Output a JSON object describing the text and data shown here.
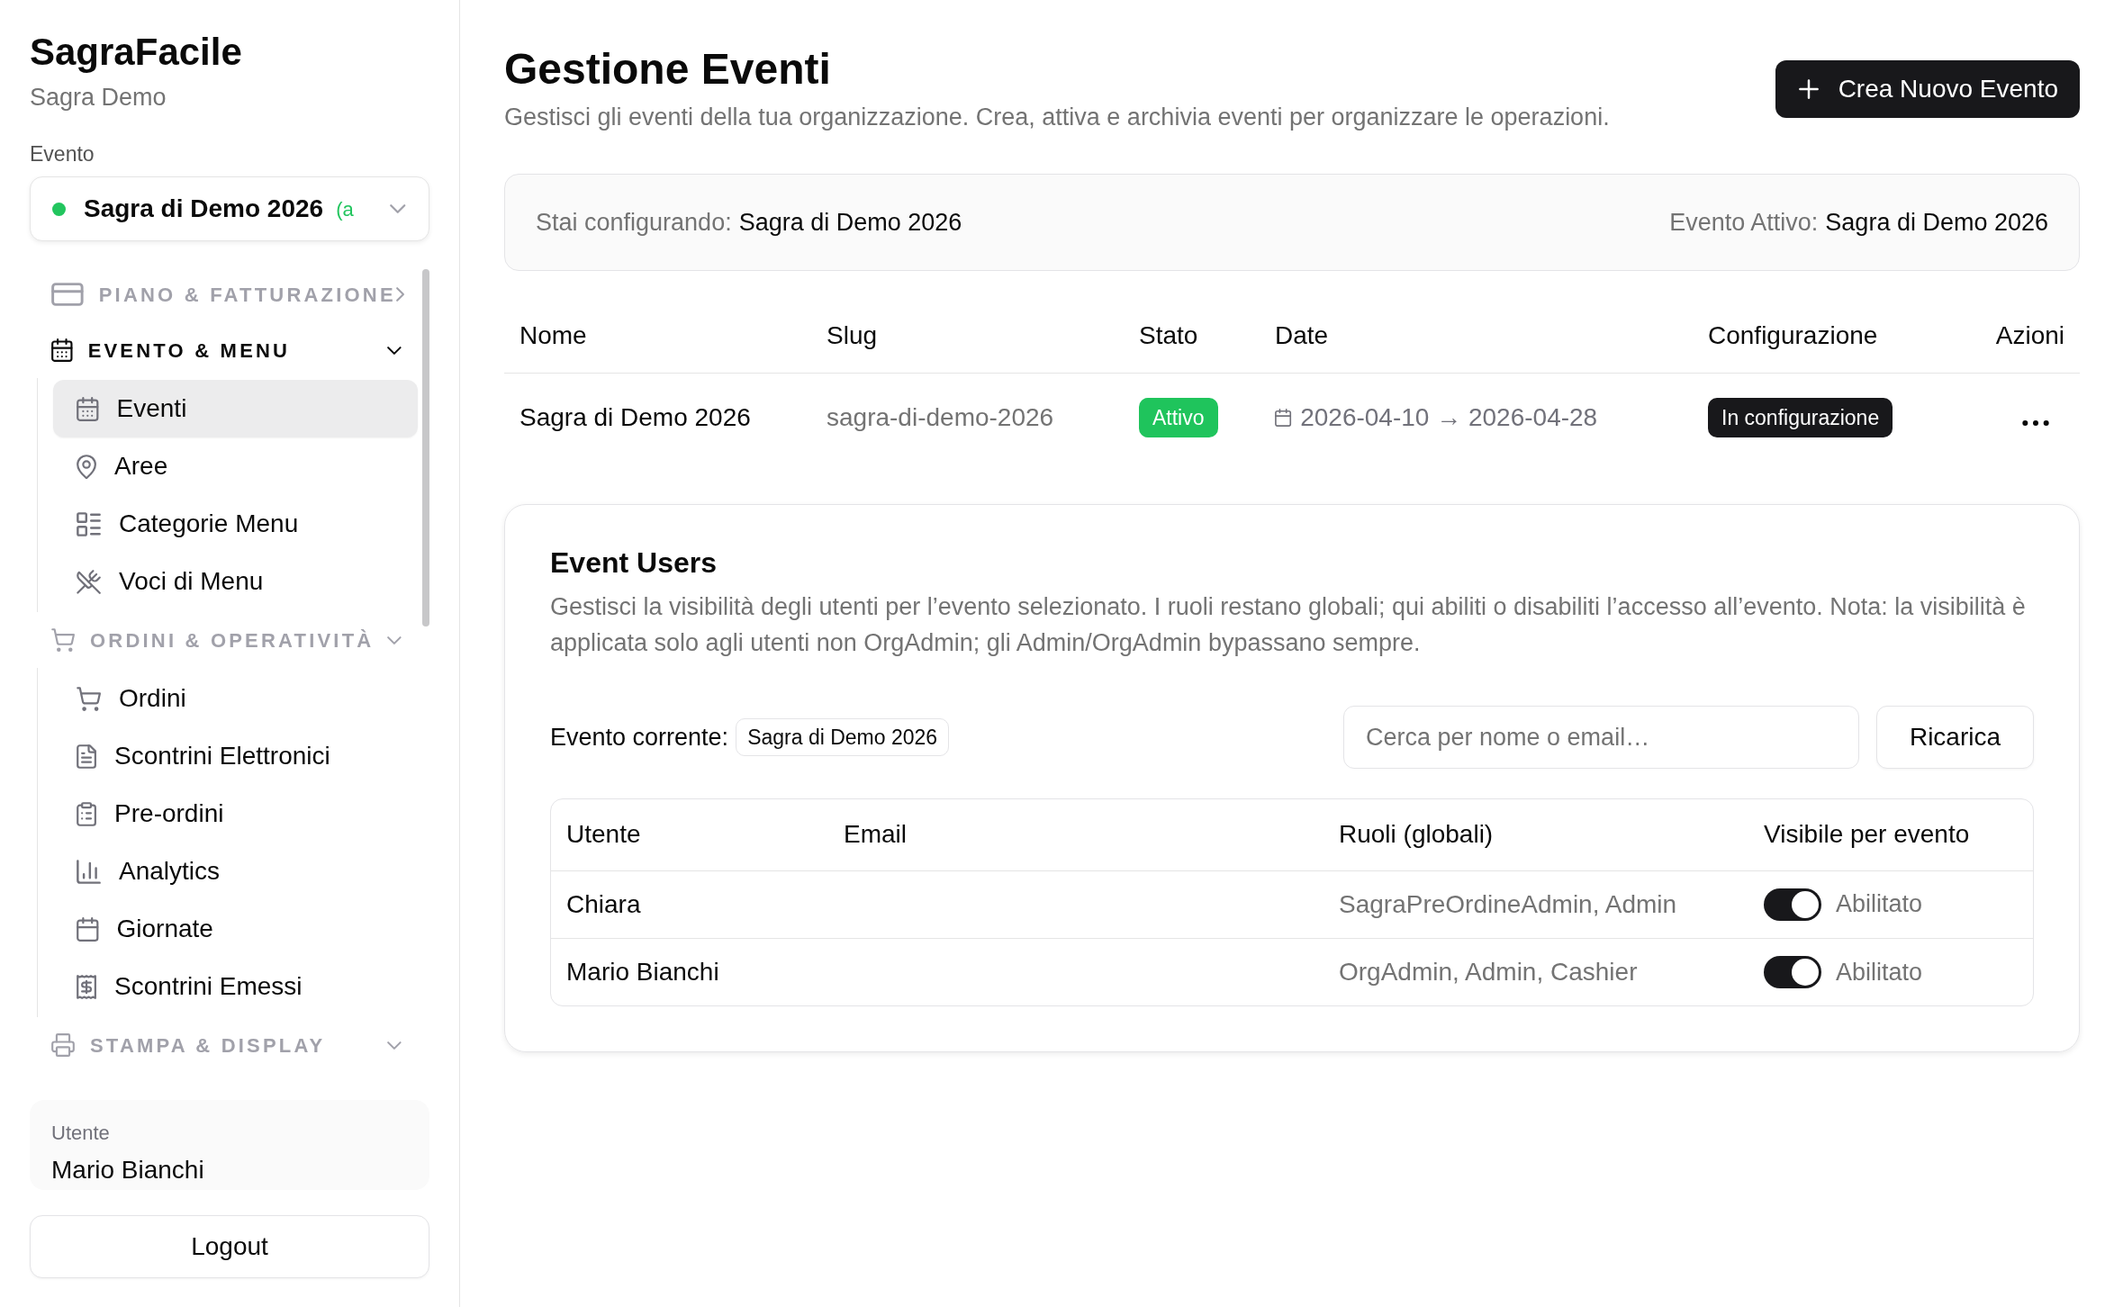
{
  "sidebar": {
    "app_title": "SagraFacile",
    "org_name": "Sagra Demo",
    "event_picker": {
      "label": "Evento",
      "value": "Sagra di Demo 2026",
      "active": true,
      "status_text": "(a"
    },
    "sections": [
      {
        "label": "PIANO & FATTURAZIONE",
        "active": false,
        "expanded": false
      },
      {
        "label": "EVENTO & MENU",
        "active": true,
        "expanded": true,
        "items": [
          {
            "label": "Eventi",
            "selected": true
          },
          {
            "label": "Aree",
            "selected": false
          },
          {
            "label": "Categorie Menu",
            "selected": false
          },
          {
            "label": "Voci di Menu",
            "selected": false
          }
        ]
      },
      {
        "label": "ORDINI & OPERATIVITÀ",
        "active": false,
        "expanded": true,
        "items": [
          {
            "label": "Ordini",
            "selected": false
          },
          {
            "label": "Scontrini Elettronici",
            "selected": false
          },
          {
            "label": "Pre-ordini",
            "selected": false
          },
          {
            "label": "Analytics",
            "selected": false
          },
          {
            "label": "Giornate",
            "selected": false
          },
          {
            "label": "Scontrini Emessi",
            "selected": false
          }
        ]
      },
      {
        "label": "STAMPA & DISPLAY",
        "active": false,
        "expanded": true
      }
    ],
    "user_card": {
      "label": "Utente",
      "name": "Mario Bianchi"
    },
    "logout_button": "Logout"
  },
  "header": {
    "title": "Gestione Eventi",
    "subtitle": "Gestisci gli eventi della tua organizzazione. Crea, attiva e archivia eventi per organizzare le operazioni.",
    "create_button": "Crea Nuovo Evento"
  },
  "context_bar": {
    "configuring_label": "Stai configurando:",
    "configuring_value": "Sagra di Demo 2026",
    "active_label": "Evento Attivo:",
    "active_value": "Sagra di Demo 2026"
  },
  "events_table": {
    "columns": [
      "Nome",
      "Slug",
      "Stato",
      "Date",
      "Configurazione",
      "Azioni"
    ],
    "rows": [
      {
        "name": "Sagra di Demo 2026",
        "slug": "sagra-di-demo-2026",
        "status": {
          "label": "Attivo",
          "kind": "active"
        },
        "dates": "2026-04-10 → 2026-04-28",
        "configuration": {
          "label": "In configurazione",
          "kind": "configuring"
        }
      }
    ]
  },
  "event_users": {
    "title": "Event Users",
    "description": "Gestisci la visibilità degli utenti per l’evento selezionato. I ruoli restano globali; qui abiliti o disabiliti l’accesso all’evento. Nota: la visibilità è applicata solo agli utenti non OrgAdmin; gli Admin/OrgAdmin bypassano sempre.",
    "current_event_label": "Evento corrente:",
    "current_event": "Sagra di Demo 2026",
    "search": {
      "placeholder": "Cerca per nome o email…"
    },
    "reload_button": "Ricarica",
    "table": {
      "columns": [
        "Utente",
        "Email",
        "Ruoli (globali)",
        "Visibile per evento"
      ],
      "rows": [
        {
          "user": "Chiara",
          "roles": "SagraPreOrdineAdmin, Admin",
          "visible": {
            "on": true,
            "label": "Abilitato"
          }
        },
        {
          "user": "Mario Bianchi",
          "roles": "OrgAdmin, Admin, Cashier",
          "visible": {
            "on": true,
            "label": "Abilitato"
          }
        }
      ]
    }
  }
}
